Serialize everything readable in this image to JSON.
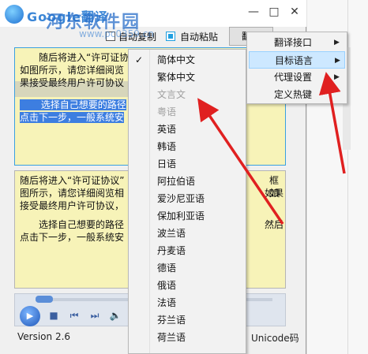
{
  "window": {
    "title": "Google翻译",
    "watermark": "河东软件园",
    "watermark_url": "www.pc0359.cn",
    "controls": {
      "minimize": "—",
      "maximize": "□",
      "close": "✕"
    }
  },
  "toolbar": {
    "auto_copy_label": "自动复制",
    "auto_copy_checked": false,
    "auto_paste_label": "自动粘贴",
    "auto_paste_checked": true,
    "translate_button": "翻译"
  },
  "source_text": {
    "line1": "随后将进入“许可证协议",
    "line2": "如图所示，请您详细阅览",
    "line3": "果接受最终用户许可协议",
    "line4": "选择自己想要的路径",
    "line5": "点击下一步，一般系统安"
  },
  "result_text": {
    "line1": "随后将进入“许可证协议”",
    "line1_tail": "框如",
    "line2": "图所示，请您详细阅览相",
    "line2_tail": "如果",
    "line3": "接受最终用户许可协议，",
    "line4": "选择自己想要的路径",
    "line4_tail": "然后",
    "line5": "点击下一步，一般系统安"
  },
  "player": {
    "play_icon": "play-icon",
    "buttons": [
      "stop-icon",
      "prev-icon",
      "next-icon",
      "volume-icon"
    ],
    "colors": {
      "accent": "#1e56b8"
    }
  },
  "status": {
    "version": "Version 2.6",
    "encoding": "Unicode码"
  },
  "context_menu": {
    "items": [
      {
        "label": "翻译接口",
        "has_submenu": true
      },
      {
        "label": "目标语言",
        "has_submenu": true,
        "active": true
      },
      {
        "label": "代理设置",
        "has_submenu": true
      },
      {
        "label": "定义热键",
        "has_submenu": false
      }
    ]
  },
  "language_menu": {
    "selected": "简体中文",
    "items": [
      {
        "label": "简体中文",
        "checked": true,
        "enabled": true
      },
      {
        "label": "繁体中文",
        "checked": false,
        "enabled": true
      },
      {
        "label": "文言文",
        "checked": false,
        "enabled": false
      },
      {
        "label": "粤语",
        "checked": false,
        "enabled": false
      },
      {
        "label": "英语",
        "checked": false,
        "enabled": true
      },
      {
        "label": "韩语",
        "checked": false,
        "enabled": true
      },
      {
        "label": "日语",
        "checked": false,
        "enabled": true
      },
      {
        "label": "阿拉伯语",
        "checked": false,
        "enabled": true
      },
      {
        "label": "爱沙尼亚语",
        "checked": false,
        "enabled": true
      },
      {
        "label": "保加利亚语",
        "checked": false,
        "enabled": true
      },
      {
        "label": "波兰语",
        "checked": false,
        "enabled": true
      },
      {
        "label": "丹麦语",
        "checked": false,
        "enabled": true
      },
      {
        "label": "德语",
        "checked": false,
        "enabled": true
      },
      {
        "label": "俄语",
        "checked": false,
        "enabled": true
      },
      {
        "label": "法语",
        "checked": false,
        "enabled": true
      },
      {
        "label": "芬兰语",
        "checked": false,
        "enabled": true
      },
      {
        "label": "荷兰语",
        "checked": false,
        "enabled": true
      }
    ]
  },
  "annotation_color": "#e02020"
}
